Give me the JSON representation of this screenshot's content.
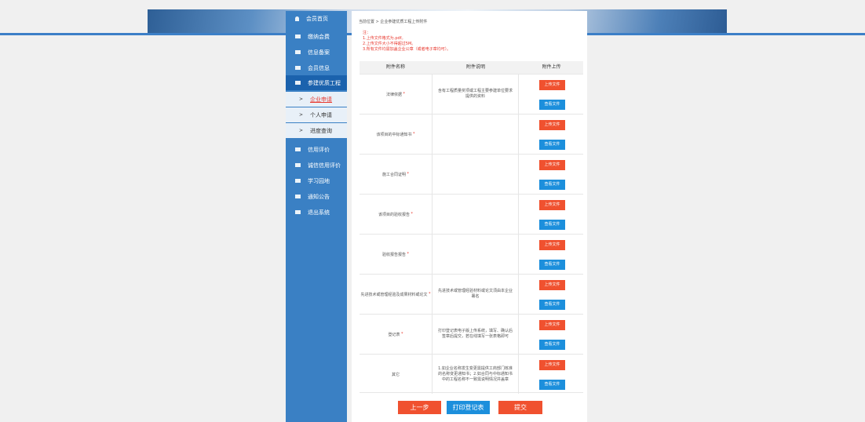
{
  "sidebar": {
    "items": [
      {
        "label": "会员首页",
        "icon": "person-icon"
      },
      {
        "label": "缴纳会费",
        "icon": "doc-icon"
      },
      {
        "label": "信息备案",
        "icon": "book-icon"
      },
      {
        "label": "会员信息",
        "icon": "card-icon"
      },
      {
        "label": "参建优质工程",
        "icon": "card-icon"
      }
    ],
    "sub_items": [
      "企业申请",
      "个人申请",
      "进度查询"
    ],
    "items_after": [
      {
        "label": "信用评价",
        "icon": "doc-icon"
      },
      {
        "label": "诚信信用评价",
        "icon": "doc-icon"
      },
      {
        "label": "学习园地",
        "icon": "card-icon"
      },
      {
        "label": "通知公告",
        "icon": "card-icon"
      },
      {
        "label": "退出系统",
        "icon": "exit-icon"
      }
    ]
  },
  "breadcrumb": "当前位置 > 企业参建优质工程上传附件",
  "notes": [
    "注：",
    "1.上传文件格式为.pdf。",
    "2.上传文件大小不得超过5M。",
    "3.所有文件均需加盖企业公章（或者电子章均可）。"
  ],
  "table": {
    "headers": [
      "附件名称",
      "附件说明",
      "附件上传"
    ],
    "rows": [
      {
        "name": "法律依据",
        "required": true,
        "desc": "含有工程质量奖项或工程主要参建单位要求提供的资料"
      },
      {
        "name": "该项目的中标通知书",
        "required": true,
        "desc": ""
      },
      {
        "name": "施工合同证明",
        "required": true,
        "desc": ""
      },
      {
        "name": "该项目的验收报告",
        "required": true,
        "desc": ""
      },
      {
        "name": "验收报告报告",
        "required": true,
        "desc": ""
      },
      {
        "name": "先进技术或管理经验及成果材料或论文",
        "required": true,
        "desc": "先进技术或管理经验材料或论文须由本企业署名"
      },
      {
        "name": "登记表",
        "required": true,
        "desc": "打印登记表电子版上传系统，填写、确认后签章后提交，若在线填写一张表格即可"
      },
      {
        "name": "其它",
        "required": false,
        "desc": "1.如企业名称发生变更需提供工商部门核准的名称变更通知书；2.如合同与中标通知书中的工程名称不一致需说明情况并盖章"
      }
    ],
    "upload_label": "上传文件",
    "view_label": "查看文件"
  },
  "buttons": {
    "prev": "上一步",
    "print": "打印登记表",
    "submit": "提交"
  },
  "colors": {
    "sidebar": "#3a80c4",
    "sidebar_active": "#1b62ad",
    "upload": "#f0512f",
    "view": "#1c8fdc",
    "required": "#e8362c"
  }
}
